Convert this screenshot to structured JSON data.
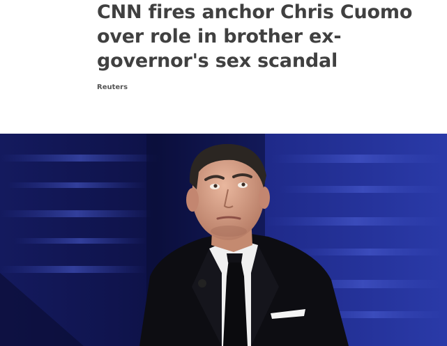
{
  "article": {
    "headline": "CNN fires anchor Chris Cuomo over role in brother ex-governor's sex scandal",
    "byline": "Reuters"
  },
  "hero_image": {
    "subject": "man-in-suit-on-stage",
    "background_color": "#1a1f6e",
    "accent_color": "#2c3fb0"
  }
}
